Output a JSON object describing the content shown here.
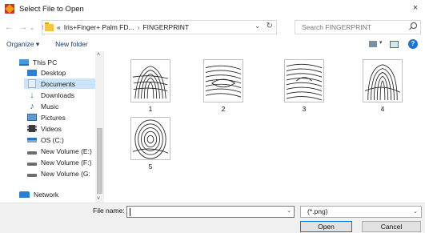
{
  "window": {
    "title": "Select File to Open",
    "close_glyph": "×"
  },
  "nav": {
    "back_glyph": "←",
    "forward_glyph": "→",
    "recent_glyph": "⌄",
    "up_glyph": "↑",
    "breadcrumb_overflow": "«",
    "breadcrumb_parent": "Iris+Finger+ Palm FD...",
    "breadcrumb_sep": "›",
    "breadcrumb_current": "FINGERPRINT",
    "dropdown_glyph": "⌄",
    "refresh_glyph": "↻"
  },
  "search": {
    "placeholder": "Search FINGERPRINT"
  },
  "toolbar": {
    "organize_label": "Organize ▾",
    "new_folder_label": "New folder",
    "view_dropdown_glyph": "▾",
    "help_glyph": "?"
  },
  "sidebar": {
    "items": [
      {
        "label": "This PC",
        "icon": "computer-icon"
      },
      {
        "label": "Desktop",
        "icon": "desktop-icon"
      },
      {
        "label": "Documents",
        "icon": "documents-icon",
        "selected": true
      },
      {
        "label": "Downloads",
        "icon": "downloads-icon"
      },
      {
        "label": "Music",
        "icon": "music-icon"
      },
      {
        "label": "Pictures",
        "icon": "pictures-icon"
      },
      {
        "label": "Videos",
        "icon": "videos-icon"
      },
      {
        "label": "OS (C:)",
        "icon": "drive-icon"
      },
      {
        "label": "New Volume (E:)",
        "icon": "drive-icon"
      },
      {
        "label": "New Volume (F:)",
        "icon": "drive-icon"
      },
      {
        "label": "New Volume (G:",
        "icon": "drive-icon"
      },
      {
        "label": "Network",
        "icon": "network-icon"
      }
    ],
    "scroll_up_glyph": "˄",
    "scroll_down_glyph": "˅"
  },
  "files": [
    {
      "name": "1"
    },
    {
      "name": "2"
    },
    {
      "name": "3"
    },
    {
      "name": "4"
    },
    {
      "name": "5"
    }
  ],
  "footer": {
    "file_name_label": "File name:",
    "file_name_value": "",
    "file_name_dropdown_glyph": "⌄",
    "filter_value": "(*.png)",
    "filter_dropdown_glyph": "⌄",
    "open_label": "Open",
    "cancel_label": "Cancel"
  },
  "colors": {
    "selection": "#cce4f7",
    "accent": "#0078d7",
    "folder": "#f4c542"
  }
}
